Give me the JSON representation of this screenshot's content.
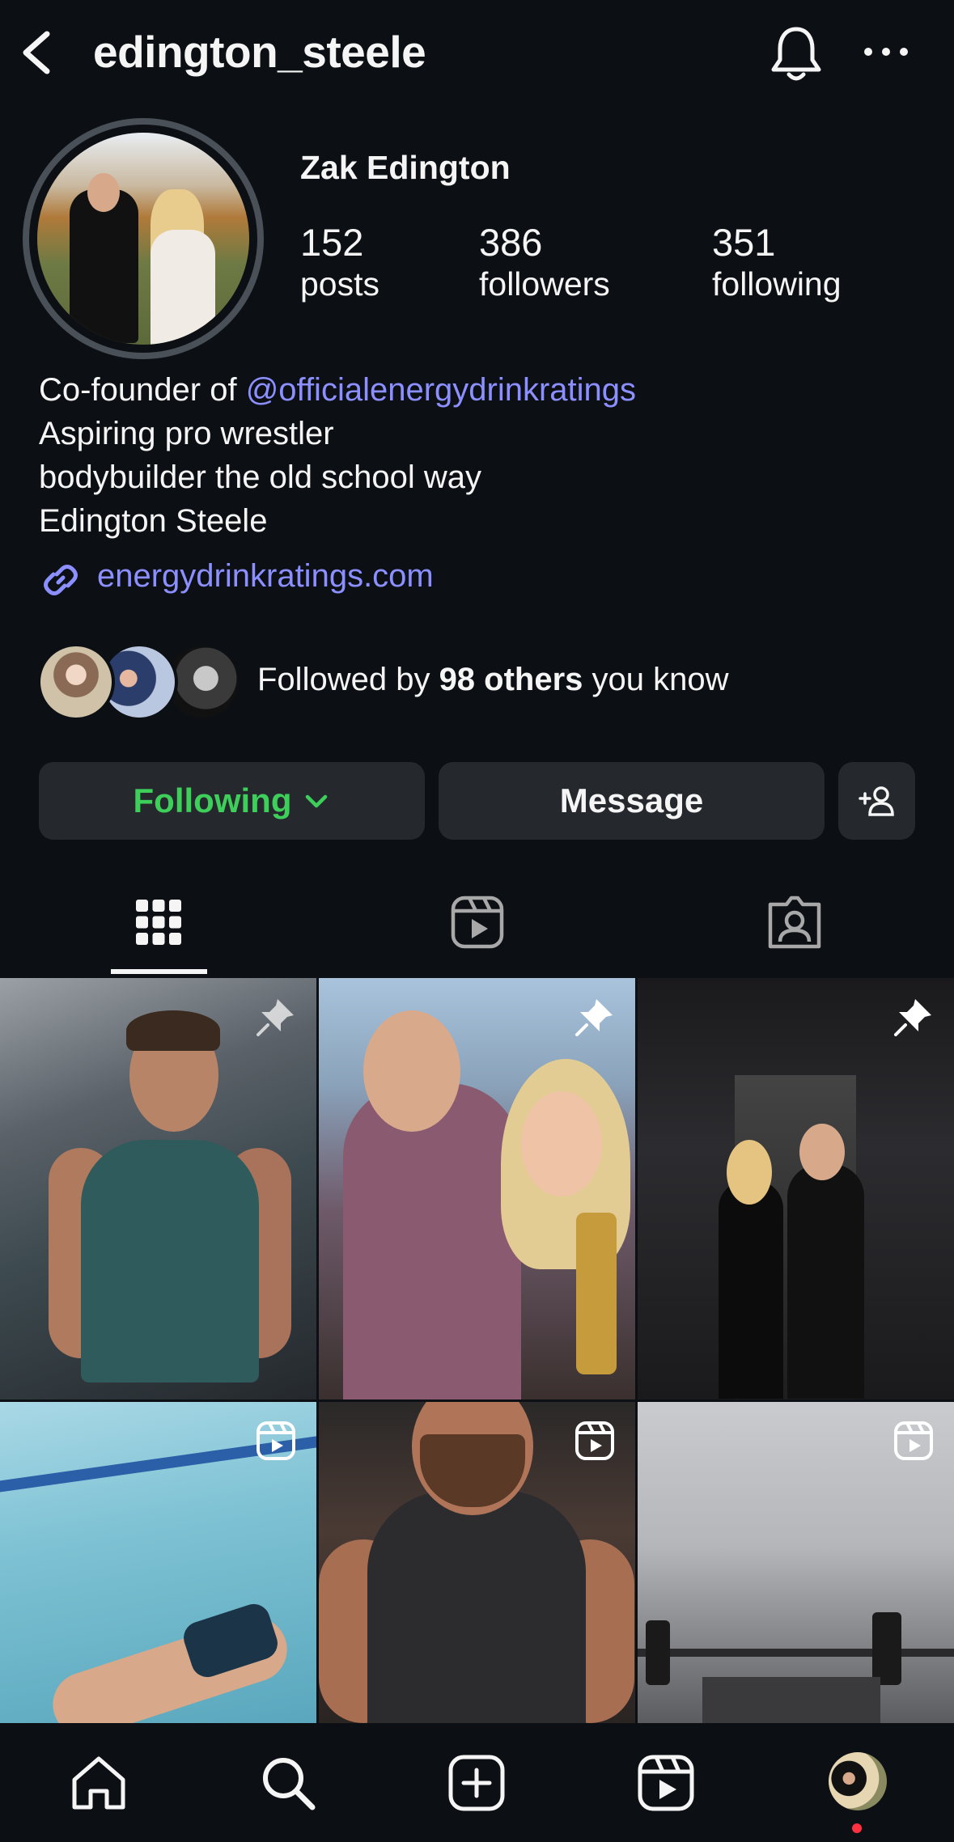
{
  "header": {
    "username": "edington_steele"
  },
  "profile": {
    "display_name": "Zak Edington",
    "stats": {
      "posts": {
        "value": "152",
        "label": "posts"
      },
      "followers": {
        "value": "386",
        "label": "followers"
      },
      "following": {
        "value": "351",
        "label": "following"
      }
    },
    "bio": {
      "line1_prefix": "Co-founder of ",
      "line1_mention": "@officialenergydrinkratings",
      "line2": "Aspiring pro wrestler",
      "line3": "bodybuilder the old school way",
      "line4": "Edington Steele"
    },
    "link": "energydrinkratings.com",
    "followed_by": {
      "prefix": "Followed by ",
      "bold": "98 others",
      "suffix": " you know"
    }
  },
  "actions": {
    "following_label": "Following",
    "message_label": "Message"
  },
  "tabs": [
    "posts-grid",
    "reels",
    "tagged"
  ],
  "grid": [
    {
      "badge": "pin-icon"
    },
    {
      "badge": "pin-icon"
    },
    {
      "badge": "pin-icon"
    },
    {
      "badge": "reels-icon"
    },
    {
      "badge": "reels-icon"
    },
    {
      "badge": "reels-icon"
    }
  ],
  "bottom_nav": [
    "home-icon",
    "search-icon",
    "create-icon",
    "reels-icon",
    "profile-avatar"
  ],
  "colors": {
    "background": "#0c1014",
    "link": "#8c8fff",
    "following_green": "#3ece5a",
    "button_bg": "#25292e",
    "notification_dot": "#ff3040"
  }
}
